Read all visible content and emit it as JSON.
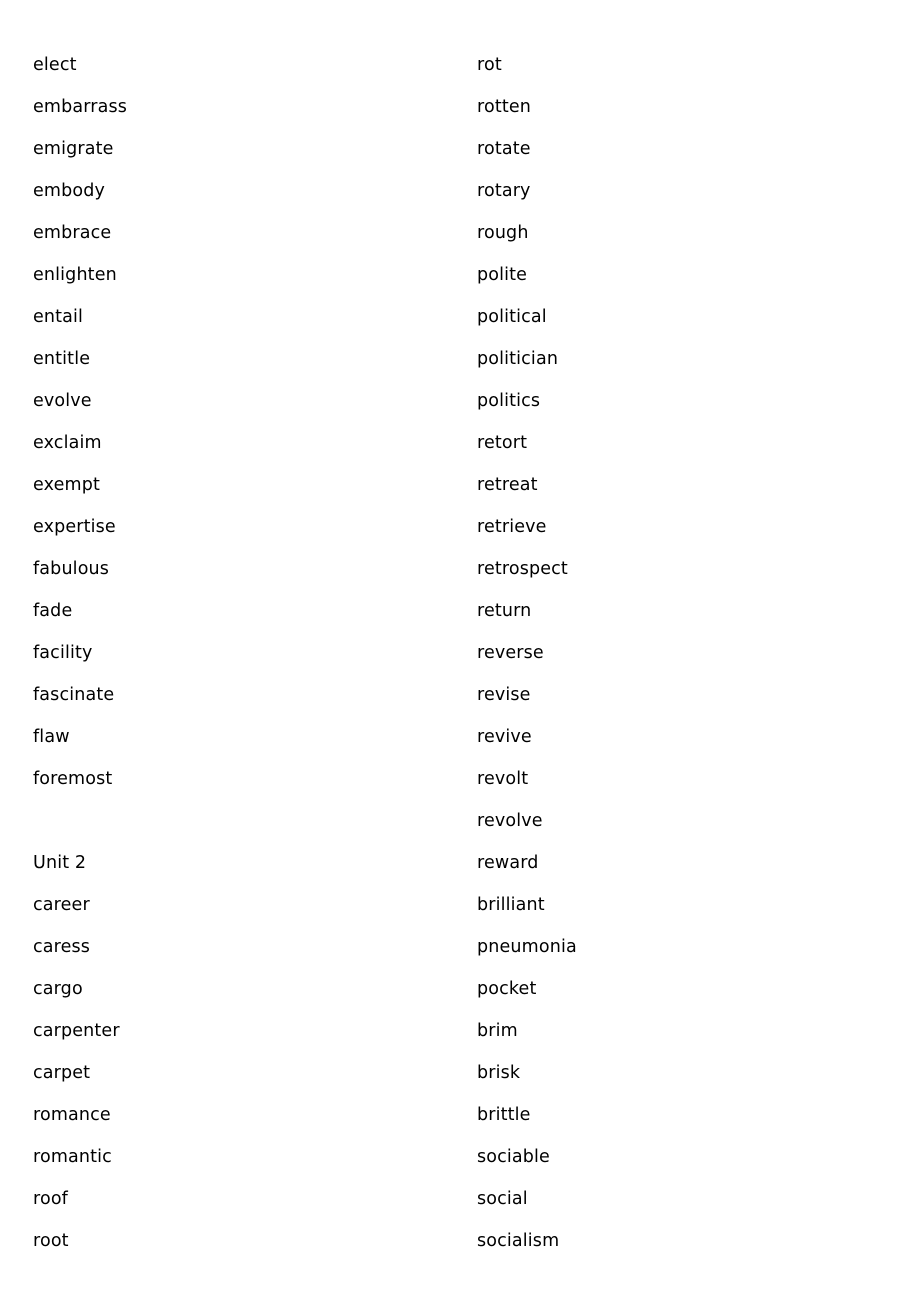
{
  "document": {
    "type": "vocabulary-word-list",
    "background_color": "#ffffff",
    "text_color": "#000000",
    "columns": [
      {
        "name": "left-column",
        "entries": [
          {
            "text": "elect",
            "kind": "word"
          },
          {
            "text": "embarrass",
            "kind": "word"
          },
          {
            "text": "emigrate",
            "kind": "word"
          },
          {
            "text": "embody",
            "kind": "word"
          },
          {
            "text": "embrace",
            "kind": "word"
          },
          {
            "text": "enlighten",
            "kind": "word"
          },
          {
            "text": "entail",
            "kind": "word"
          },
          {
            "text": "entitle",
            "kind": "word"
          },
          {
            "text": "evolve",
            "kind": "word"
          },
          {
            "text": "exclaim",
            "kind": "word"
          },
          {
            "text": "exempt",
            "kind": "word"
          },
          {
            "text": "expertise",
            "kind": "word"
          },
          {
            "text": "fabulous",
            "kind": "word"
          },
          {
            "text": "fade",
            "kind": "word"
          },
          {
            "text": "facility",
            "kind": "word"
          },
          {
            "text": "fascinate",
            "kind": "word"
          },
          {
            "text": "flaw",
            "kind": "word"
          },
          {
            "text": "foremost",
            "kind": "word"
          },
          {
            "text": "",
            "kind": "blank"
          },
          {
            "text": "Unit 2",
            "kind": "section-heading"
          },
          {
            "text": "career",
            "kind": "word"
          },
          {
            "text": "caress",
            "kind": "word"
          },
          {
            "text": "cargo",
            "kind": "word"
          },
          {
            "text": "carpenter",
            "kind": "word"
          },
          {
            "text": "carpet",
            "kind": "word"
          },
          {
            "text": "romance",
            "kind": "word"
          },
          {
            "text": "romantic",
            "kind": "word"
          },
          {
            "text": "roof",
            "kind": "word"
          },
          {
            "text": "root",
            "kind": "word"
          }
        ]
      },
      {
        "name": "right-column",
        "entries": [
          {
            "text": "rot",
            "kind": "word"
          },
          {
            "text": "rotten",
            "kind": "word"
          },
          {
            "text": "rotate",
            "kind": "word"
          },
          {
            "text": "rotary",
            "kind": "word"
          },
          {
            "text": "rough",
            "kind": "word"
          },
          {
            "text": "polite",
            "kind": "word"
          },
          {
            "text": "political",
            "kind": "word"
          },
          {
            "text": "politician",
            "kind": "word"
          },
          {
            "text": "politics",
            "kind": "word"
          },
          {
            "text": "retort",
            "kind": "word"
          },
          {
            "text": "retreat",
            "kind": "word"
          },
          {
            "text": "retrieve",
            "kind": "word"
          },
          {
            "text": "retrospect",
            "kind": "word"
          },
          {
            "text": "return",
            "kind": "word"
          },
          {
            "text": "reverse",
            "kind": "word"
          },
          {
            "text": "revise",
            "kind": "word"
          },
          {
            "text": "revive",
            "kind": "word"
          },
          {
            "text": "revolt",
            "kind": "word"
          },
          {
            "text": "revolve",
            "kind": "word"
          },
          {
            "text": "reward",
            "kind": "word"
          },
          {
            "text": "brilliant",
            "kind": "word"
          },
          {
            "text": "pneumonia",
            "kind": "word"
          },
          {
            "text": "pocket",
            "kind": "word"
          },
          {
            "text": "brim",
            "kind": "word"
          },
          {
            "text": "brisk",
            "kind": "word"
          },
          {
            "text": "brittle",
            "kind": "word"
          },
          {
            "text": "sociable",
            "kind": "word"
          },
          {
            "text": "social",
            "kind": "word"
          },
          {
            "text": "socialism",
            "kind": "word"
          }
        ]
      }
    ]
  }
}
